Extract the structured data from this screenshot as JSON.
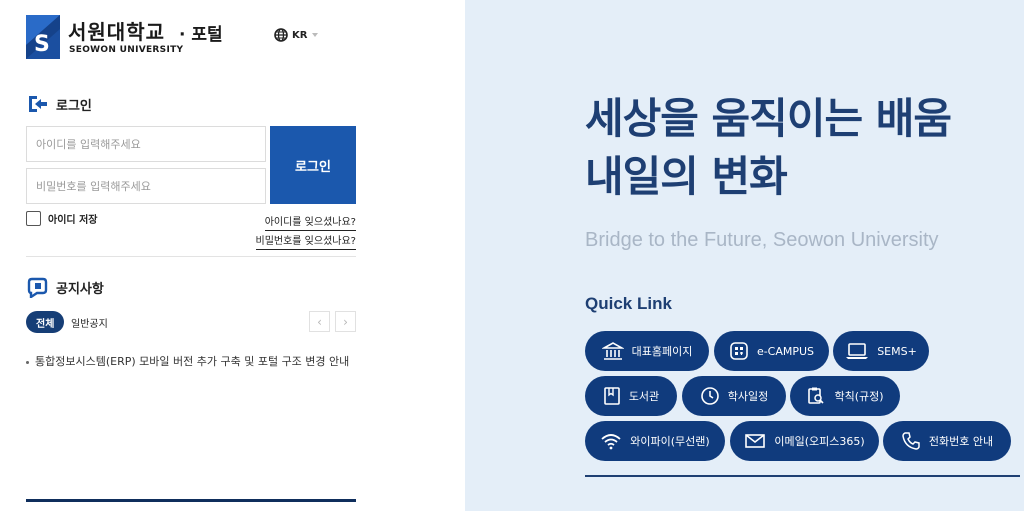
{
  "brand": {
    "name_kr": "서원대학교",
    "name_en": "SEOWON UNIVERSITY",
    "portal": "· 포털",
    "logo_letter": "S"
  },
  "language": {
    "label": "KR",
    "icon": "globe-icon"
  },
  "login": {
    "title": "로그인",
    "icon": "login-arrow-icon",
    "id_placeholder": "아이디를 입력해주세요",
    "pw_placeholder": "비밀번호를 입력해주세요",
    "button_label": "로그인",
    "save_id_label": "아이디 저장",
    "save_id_checked": false,
    "find_id": "아이디를 잊으셨나요?",
    "find_pw": "비밀번호를 잊으셨나요?"
  },
  "notice": {
    "title": "공지사항",
    "icon": "megaphone-icon",
    "tabs": [
      {
        "label": "전체",
        "active": true
      },
      {
        "label": "일반공지",
        "active": false
      }
    ],
    "prev_glyph": "‹",
    "next_glyph": "›",
    "items": [
      "통합정보시스템(ERP) 모바일 버전 추가 구축 및 포털 구조 변경 안내"
    ]
  },
  "hero": {
    "line1": "세상을 움직이는 배움",
    "line2": "내일의 변화",
    "subtitle": "Bridge to the Future, Seowon University"
  },
  "quick_link": {
    "title": "Quick Link",
    "items": [
      {
        "label": "대표홈페이지",
        "icon": "building-icon"
      },
      {
        "label": "e-CAMPUS",
        "icon": "campus-icon"
      },
      {
        "label": "SEMS+",
        "icon": "laptop-icon"
      },
      {
        "label": "도서관",
        "icon": "book-icon"
      },
      {
        "label": "학사일정",
        "icon": "clock-icon"
      },
      {
        "label": "학칙(규정)",
        "icon": "clipboard-search-icon"
      },
      {
        "label": "와이파이(무선랜)",
        "icon": "wifi-icon"
      },
      {
        "label": "이메일(오피스365)",
        "icon": "mail-icon"
      },
      {
        "label": "전화번호 안내",
        "icon": "phone-icon"
      }
    ]
  },
  "colors": {
    "primary": "#1b58ad",
    "navy": "#103b7d",
    "headline": "#1e3f73",
    "right_bg": "#e4eef8",
    "subtitle": "#a9b6c6"
  }
}
